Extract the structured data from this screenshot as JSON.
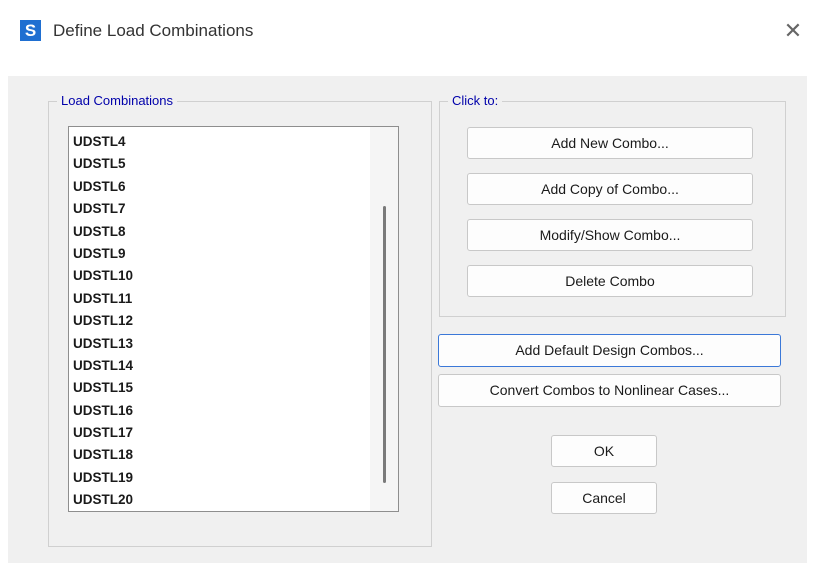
{
  "window": {
    "app_icon_letter": "S",
    "title": "Define Load Combinations",
    "close_glyph": "✕"
  },
  "load_combinations": {
    "legend": "Load Combinations",
    "items": [
      "UDSTL4",
      "UDSTL5",
      "UDSTL6",
      "UDSTL7",
      "UDSTL8",
      "UDSTL9",
      "UDSTL10",
      "UDSTL11",
      "UDSTL12",
      "UDSTL13",
      "UDSTL14",
      "UDSTL15",
      "UDSTL16",
      "UDSTL17",
      "UDSTL18",
      "UDSTL19",
      "UDSTL20"
    ]
  },
  "click_to": {
    "legend": "Click to:",
    "add_new_label": "Add New Combo...",
    "add_copy_label": "Add Copy of Combo...",
    "modify_label": "Modify/Show Combo...",
    "delete_label": "Delete Combo"
  },
  "actions": {
    "add_default_label": "Add Default Design Combos...",
    "convert_label": "Convert Combos to Nonlinear Cases...",
    "ok_label": "OK",
    "cancel_label": "Cancel"
  },
  "colors": {
    "app_icon": "#1f6fd1",
    "legend_text": "#0000aa",
    "dialog_background": "#f0f0f0",
    "focus_border": "#3b78d8"
  }
}
